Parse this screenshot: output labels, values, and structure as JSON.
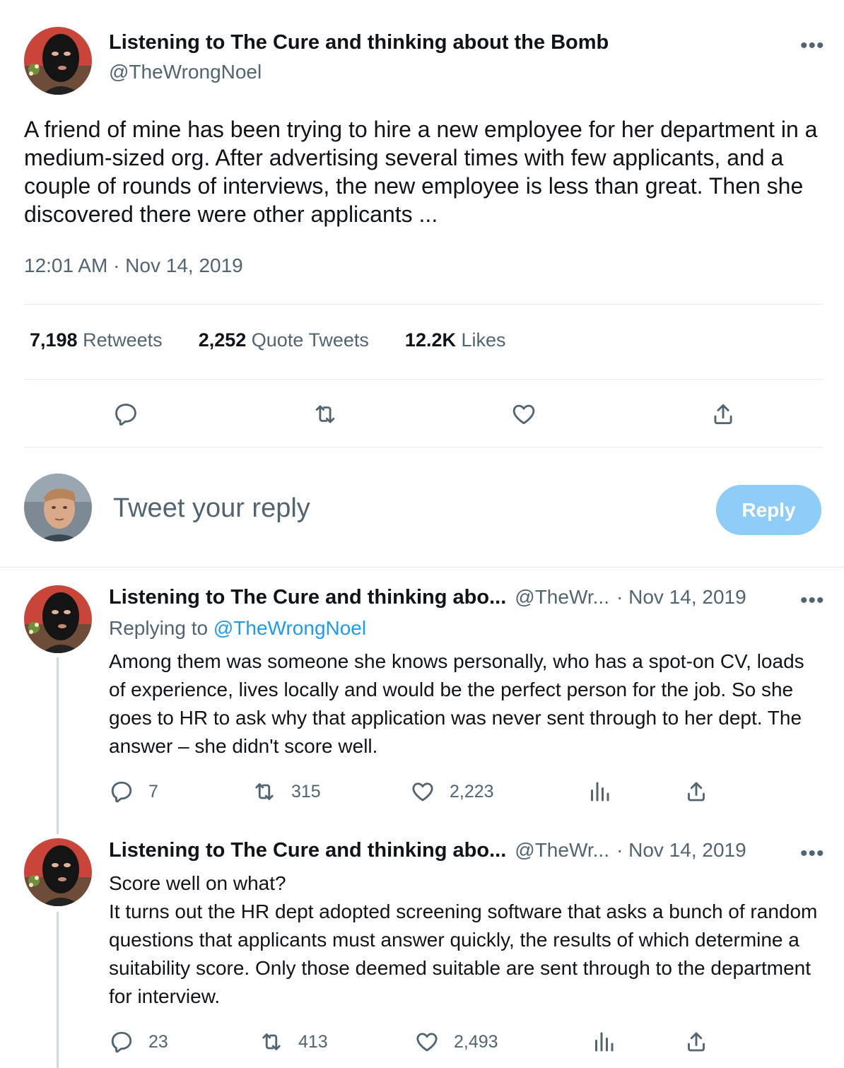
{
  "main_tweet": {
    "display_name": "Listening to The Cure and thinking about the Bomb",
    "handle": "@TheWrongNoel",
    "text": "A friend of mine has been trying to hire a new employee for her department in a medium-sized org. After advertising several times with few applicants, and a couple of rounds of interviews, the new employee is less than great. Then she discovered there were other applicants ...",
    "timestamp": "12:01 AM · Nov 14, 2019",
    "stats": {
      "retweets_count": "7,198",
      "retweets_label": "Retweets",
      "quotes_count": "2,252",
      "quotes_label": "Quote Tweets",
      "likes_count": "12.2K",
      "likes_label": "Likes"
    },
    "actions": [
      "reply-icon",
      "retweet-icon",
      "like-icon",
      "share-icon"
    ]
  },
  "composer": {
    "placeholder": "Tweet your reply",
    "button_label": "Reply"
  },
  "replies": [
    {
      "display_name": "Listening to The Cure and thinking abo...",
      "handle": "@TheWr...",
      "date": "· Nov 14, 2019",
      "replying_to_label": "Replying to",
      "replying_to_handle": "@TheWrongNoel",
      "text": "Among them was someone she knows personally, who has a spot-on CV, loads of experience, lives locally and would be the perfect person for the job. So she goes to HR to ask why that application was never sent through to her dept. The answer – she didn't score well.",
      "reply_count": "7",
      "retweet_count": "315",
      "like_count": "2,223"
    },
    {
      "display_name": "Listening to The Cure and thinking abo...",
      "handle": "@TheWr...",
      "date": "· Nov 14, 2019",
      "text_line1": "Score well on what?",
      "text": "It turns out the HR dept adopted screening software that asks a bunch of random questions that applicants must answer quickly, the results of which determine a suitability score. Only those deemed suitable are sent through to the department for interview.",
      "reply_count": "23",
      "retweet_count": "413",
      "like_count": "2,493"
    }
  ],
  "more_icon": "•••",
  "colors": {
    "text": "#0f1419",
    "muted": "#536471",
    "link": "#1d9bf0",
    "reply_button_disabled": "#8ecdf8",
    "divider": "#e6ecf0",
    "thread_line": "#cfd9de"
  }
}
